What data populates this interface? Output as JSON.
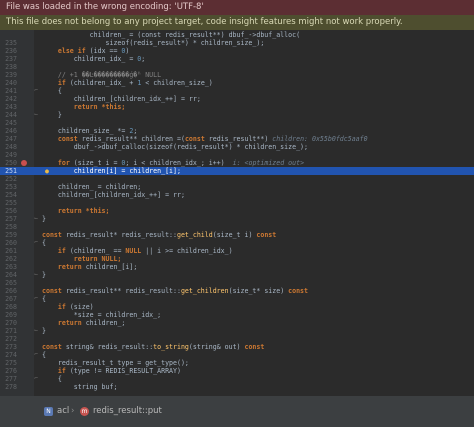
{
  "banners": {
    "encoding": "File was loaded in the wrong encoding: 'UTF-8'",
    "project": "This file does not belong to any project target, code insight features might not work properly."
  },
  "editor": {
    "current_line": 251,
    "lines": [
      {
        "n": "",
        "s": [
          {
            "t": "            children_ = (const redis_result**) dbuf_->dbuf_alloc(",
            "c": "txt"
          }
        ]
      },
      {
        "n": "235",
        "s": [
          {
            "t": "                sizeof(redis_result*) * children_size_);",
            "c": "txt"
          }
        ]
      },
      {
        "n": "236",
        "s": [
          {
            "t": "    ",
            "c": "txt"
          },
          {
            "t": "else if",
            "c": "kw"
          },
          {
            "t": " (idx == ",
            "c": "txt"
          },
          {
            "t": "0",
            "c": "num"
          },
          {
            "t": ")",
            "c": "txt"
          }
        ]
      },
      {
        "n": "237",
        "s": [
          {
            "t": "        children_idx_ = ",
            "c": "txt"
          },
          {
            "t": "0",
            "c": "num"
          },
          {
            "t": ";",
            "c": "txt"
          }
        ]
      },
      {
        "n": "238",
        "s": []
      },
      {
        "n": "239",
        "s": [
          {
            "t": "    // +1 ��Ŀ���������ǵ�ʱ NULL",
            "c": "cm"
          }
        ]
      },
      {
        "n": "240",
        "s": [
          {
            "t": "    ",
            "c": "txt"
          },
          {
            "t": "if",
            "c": "kw"
          },
          {
            "t": " (children_idx_ + ",
            "c": "txt"
          },
          {
            "t": "1",
            "c": "num"
          },
          {
            "t": " < children_size_)",
            "c": "txt"
          }
        ]
      },
      {
        "n": "241",
        "s": [
          {
            "t": "    {",
            "c": "txt"
          }
        ]
      },
      {
        "n": "242",
        "s": [
          {
            "t": "        children_[children_idx_++] = rr;",
            "c": "txt"
          }
        ]
      },
      {
        "n": "243",
        "s": [
          {
            "t": "        ",
            "c": "txt"
          },
          {
            "t": "return *this;",
            "c": "kw"
          }
        ]
      },
      {
        "n": "244",
        "s": [
          {
            "t": "    }",
            "c": "txt"
          }
        ]
      },
      {
        "n": "245",
        "s": []
      },
      {
        "n": "246",
        "s": [
          {
            "t": "    children_size_ *= ",
            "c": "txt"
          },
          {
            "t": "2",
            "c": "num"
          },
          {
            "t": ";",
            "c": "txt"
          }
        ]
      },
      {
        "n": "247",
        "s": [
          {
            "t": "    ",
            "c": "txt"
          },
          {
            "t": "const",
            "c": "kw"
          },
          {
            "t": " redis_result** children =(",
            "c": "txt"
          },
          {
            "t": "const",
            "c": "kw"
          },
          {
            "t": " redis_result**)",
            "c": "txt"
          },
          {
            "t": " children: 0x55b0fdc5aaf0",
            "c": "inlay"
          }
        ]
      },
      {
        "n": "248",
        "s": [
          {
            "t": "        dbuf_->dbuf_calloc(sizeof(redis_result*) * children_size_);",
            "c": "txt"
          }
        ]
      },
      {
        "n": "249",
        "s": []
      },
      {
        "n": "250",
        "s": [
          {
            "t": "    ",
            "c": "txt"
          },
          {
            "t": "for",
            "c": "kw"
          },
          {
            "t": " (size_t i = ",
            "c": "txt"
          },
          {
            "t": "0",
            "c": "num"
          },
          {
            "t": "; i < children_idx_; i++)",
            "c": "txt"
          },
          {
            "t": "  i: <optimized out>",
            "c": "inlay"
          }
        ]
      },
      {
        "n": "251",
        "s": [
          {
            "t": "        children[i] = children_[i];",
            "c": "txt"
          }
        ]
      },
      {
        "n": "252",
        "s": []
      },
      {
        "n": "253",
        "s": [
          {
            "t": "    children_ = children;",
            "c": "txt"
          }
        ]
      },
      {
        "n": "254",
        "s": [
          {
            "t": "    children_[children_idx_++] = rr;",
            "c": "txt"
          }
        ]
      },
      {
        "n": "255",
        "s": []
      },
      {
        "n": "256",
        "s": [
          {
            "t": "    ",
            "c": "txt"
          },
          {
            "t": "return *this;",
            "c": "kw"
          }
        ]
      },
      {
        "n": "257",
        "s": [
          {
            "t": "}",
            "c": "txt"
          }
        ]
      },
      {
        "n": "258",
        "s": []
      },
      {
        "n": "259",
        "s": [
          {
            "t": "const",
            "c": "kw"
          },
          {
            "t": " redis_result* redis_result::",
            "c": "txt"
          },
          {
            "t": "get_child",
            "c": "fn"
          },
          {
            "t": "(size_t i) ",
            "c": "txt"
          },
          {
            "t": "const",
            "c": "kw"
          }
        ]
      },
      {
        "n": "260",
        "s": [
          {
            "t": "{",
            "c": "txt"
          }
        ]
      },
      {
        "n": "261",
        "s": [
          {
            "t": "    ",
            "c": "txt"
          },
          {
            "t": "if",
            "c": "kw"
          },
          {
            "t": " (children_ == ",
            "c": "txt"
          },
          {
            "t": "NULL",
            "c": "kw"
          },
          {
            "t": " || i >= children_idx_)",
            "c": "txt"
          }
        ]
      },
      {
        "n": "262",
        "s": [
          {
            "t": "        ",
            "c": "txt"
          },
          {
            "t": "return NULL;",
            "c": "kw"
          }
        ]
      },
      {
        "n": "263",
        "s": [
          {
            "t": "    ",
            "c": "txt"
          },
          {
            "t": "return",
            "c": "kw"
          },
          {
            "t": " children_[i];",
            "c": "txt"
          }
        ]
      },
      {
        "n": "264",
        "s": [
          {
            "t": "}",
            "c": "txt"
          }
        ]
      },
      {
        "n": "265",
        "s": []
      },
      {
        "n": "266",
        "s": [
          {
            "t": "const",
            "c": "kw"
          },
          {
            "t": " redis_result** redis_result::",
            "c": "txt"
          },
          {
            "t": "get_children",
            "c": "fn"
          },
          {
            "t": "(size_t* size) ",
            "c": "txt"
          },
          {
            "t": "const",
            "c": "kw"
          }
        ]
      },
      {
        "n": "267",
        "s": [
          {
            "t": "{",
            "c": "txt"
          }
        ]
      },
      {
        "n": "268",
        "s": [
          {
            "t": "    ",
            "c": "txt"
          },
          {
            "t": "if",
            "c": "kw"
          },
          {
            "t": " (size)",
            "c": "txt"
          }
        ]
      },
      {
        "n": "269",
        "s": [
          {
            "t": "        *size = children_idx_;",
            "c": "txt"
          }
        ]
      },
      {
        "n": "270",
        "s": [
          {
            "t": "    ",
            "c": "txt"
          },
          {
            "t": "return",
            "c": "kw"
          },
          {
            "t": " children_;",
            "c": "txt"
          }
        ]
      },
      {
        "n": "271",
        "s": [
          {
            "t": "}",
            "c": "txt"
          }
        ]
      },
      {
        "n": "272",
        "s": []
      },
      {
        "n": "273",
        "s": [
          {
            "t": "const",
            "c": "kw"
          },
          {
            "t": " string& redis_result::",
            "c": "txt"
          },
          {
            "t": "to_string",
            "c": "fn"
          },
          {
            "t": "(string& out) ",
            "c": "txt"
          },
          {
            "t": "const",
            "c": "kw"
          }
        ]
      },
      {
        "n": "274",
        "s": [
          {
            "t": "{",
            "c": "txt"
          }
        ]
      },
      {
        "n": "275",
        "s": [
          {
            "t": "    redis_result_t type = get_type();",
            "c": "txt"
          }
        ]
      },
      {
        "n": "276",
        "s": [
          {
            "t": "    ",
            "c": "txt"
          },
          {
            "t": "if",
            "c": "kw"
          },
          {
            "t": " (type != REDIS_RESULT_ARRAY)",
            "c": "txt"
          }
        ]
      },
      {
        "n": "277",
        "s": [
          {
            "t": "    {",
            "c": "txt"
          }
        ]
      },
      {
        "n": "278",
        "s": [
          {
            "t": "        string buf;",
            "c": "txt"
          }
        ]
      }
    ]
  },
  "breadcrumb": {
    "namespace": "acl",
    "method": "redis_result::put"
  },
  "colors": {
    "background": "#2b2b2b",
    "current_line": "#2154b0",
    "keyword": "#cc7832",
    "number": "#6897bb",
    "breakpoint": "#c94f4f"
  }
}
